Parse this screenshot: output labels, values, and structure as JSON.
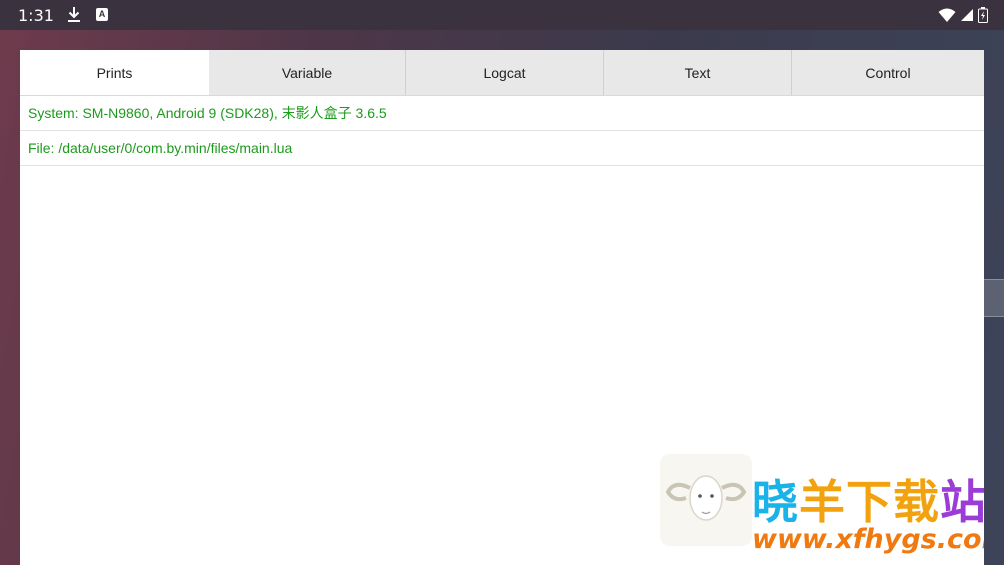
{
  "status_bar": {
    "time": "1:31",
    "icons": [
      "download-icon",
      "app-a-icon",
      "wifi-icon",
      "signal-icon",
      "battery-icon"
    ],
    "app_icon_letter": "A"
  },
  "tabs": [
    {
      "label": "Prints",
      "active": true
    },
    {
      "label": "Variable",
      "active": false
    },
    {
      "label": "Logcat",
      "active": false
    },
    {
      "label": "Text",
      "active": false
    },
    {
      "label": "Control",
      "active": false
    }
  ],
  "log": {
    "lines": [
      "System: SM-N9860, Android 9 (SDK28), 末影人盒子 3.6.5",
      "File: /data/user/0/com.by.min/files/main.lua"
    ],
    "text_color": "#1d9a1d"
  },
  "watermark": {
    "cn_part1": "晓",
    "cn_part2": "羊下载",
    "cn_part3": "站",
    "url": "www.xfhygs.com"
  }
}
